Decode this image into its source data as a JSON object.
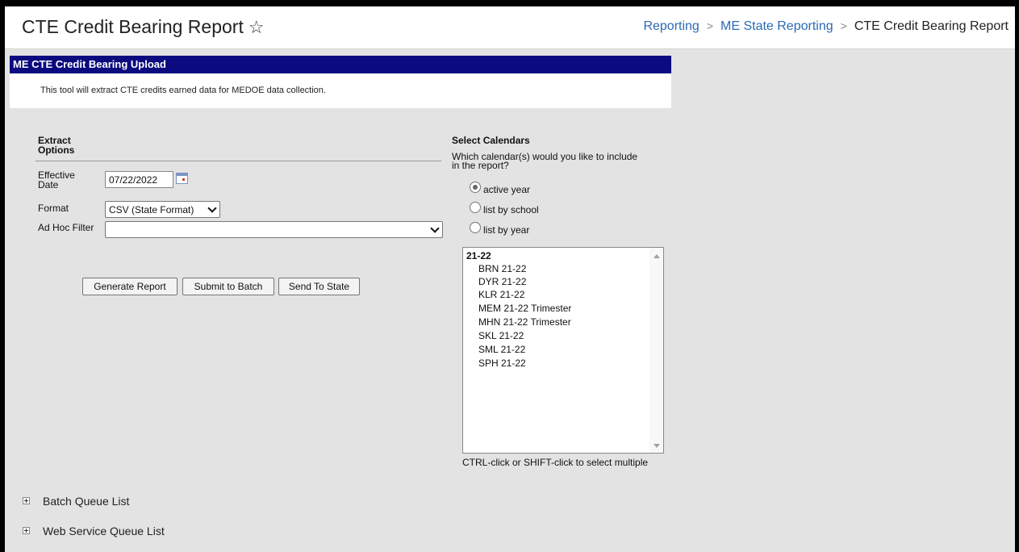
{
  "header": {
    "title": "CTE Credit Bearing Report",
    "breadcrumb": [
      "Reporting",
      "ME State Reporting"
    ],
    "breadcrumb_current": "CTE Credit Bearing Report"
  },
  "panel": {
    "title": "ME CTE Credit Bearing Upload",
    "description": "This tool will extract CTE credits earned data for MEDOE data collection."
  },
  "extract_options": {
    "title_line1": "Extract",
    "title_line2": "Options",
    "effective_date_label_line1": "Effective",
    "effective_date_label_line2": "Date",
    "effective_date_value": "07/22/2022",
    "format_label": "Format",
    "format_value": "CSV (State Format)",
    "ad_hoc_label": "Ad Hoc Filter",
    "ad_hoc_value": ""
  },
  "buttons": {
    "generate": "Generate Report",
    "submit_batch": "Submit to Batch",
    "send_state": "Send To State"
  },
  "calendars": {
    "title": "Select Calendars",
    "question_line1": "Which calendar(s) would you like to include",
    "question_line2": "in the report?",
    "options": [
      "active year",
      "list by school",
      "list by year"
    ],
    "selected_option": "active year",
    "group": "21-22",
    "items": [
      "BRN 21-22",
      "DYR 21-22",
      "KLR 21-22",
      "MEM 21-22 Trimester",
      "MHN 21-22 Trimester",
      "SKL 21-22",
      "SML 21-22",
      "SPH 21-22"
    ],
    "hint": "CTRL-click or SHIFT-click to select multiple"
  },
  "queues": [
    "Batch Queue List",
    "Web Service Queue List"
  ]
}
